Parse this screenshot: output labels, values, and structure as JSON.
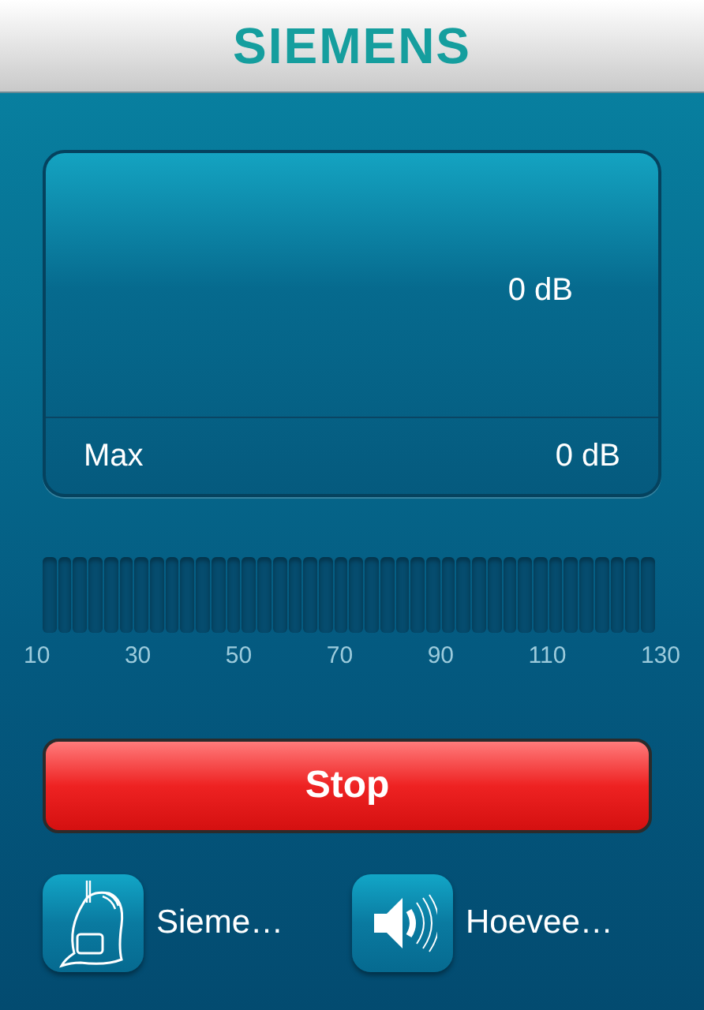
{
  "header": {
    "logo": "SIEMENS"
  },
  "display": {
    "reading": "0 dB",
    "max_label": "Max",
    "max_reading": "0 dB"
  },
  "meter": {
    "level": 0,
    "ticks": [
      "10",
      "30",
      "50",
      "70",
      "90",
      "110",
      "130"
    ]
  },
  "stop_button": {
    "label": "Stop"
  },
  "shortcuts": [
    {
      "kind": "hearing-aid",
      "label": "Sieme…"
    },
    {
      "kind": "speaker",
      "label": "Hoevee…"
    }
  ]
}
